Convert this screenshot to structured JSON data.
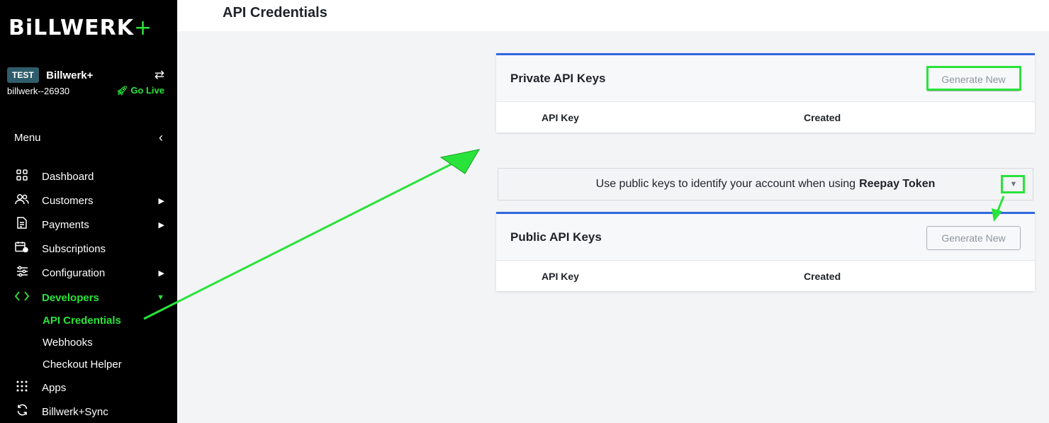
{
  "brand": {
    "logo_text": "BiLLWERK",
    "logo_plus": "+"
  },
  "account": {
    "badge": "TEST",
    "name": "Billwerk+",
    "id": "billwerk--26930",
    "go_live": "Go Live"
  },
  "menu": {
    "label": "Menu"
  },
  "nav": [
    {
      "label": "Dashboard",
      "icon": "grid-icon"
    },
    {
      "label": "Customers",
      "icon": "users-icon"
    },
    {
      "label": "Payments",
      "icon": "receipt-icon"
    },
    {
      "label": "Subscriptions",
      "icon": "calendar-icon"
    },
    {
      "label": "Configuration",
      "icon": "sliders-icon"
    },
    {
      "label": "Developers",
      "icon": "code-icon"
    },
    {
      "label": "Apps",
      "icon": "apps-icon"
    },
    {
      "label": "Billwerk+Sync",
      "icon": "sync-icon"
    }
  ],
  "developers_sub": [
    "API Credentials",
    "Webhooks",
    "Checkout Helper"
  ],
  "page": {
    "title": "API Credentials"
  },
  "private_keys": {
    "title": "Private API Keys",
    "button": "Generate New",
    "columns": [
      "API Key",
      "Created"
    ]
  },
  "info": {
    "text": "Use public keys to identify your account when using",
    "bold": "Reepay Token"
  },
  "public_keys": {
    "title": "Public API Keys",
    "button": "Generate New",
    "columns": [
      "API Key",
      "Created"
    ]
  },
  "colors": {
    "accent": "#29e33a",
    "card_border": "#3168e0",
    "sidebar_bg": "#000000"
  }
}
